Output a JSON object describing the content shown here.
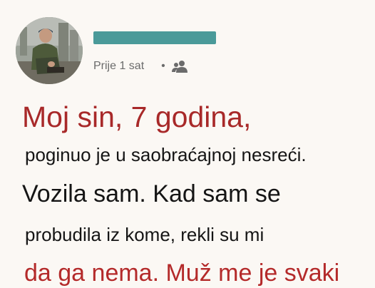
{
  "post": {
    "author": {
      "avatar_icon": "avatar-photo",
      "name_redaction_color": "#4a9a99"
    },
    "timestamp": "Prije 1 sat",
    "separator": "•",
    "audience_icon": "friends-icon",
    "body": {
      "line1": "Moj sin, 7 godina,",
      "line2": "poginuo je u saobraćajnoj nesreći.",
      "line3": "Vozila sam. Kad sam se",
      "line4": "probudila iz kome, rekli su mi",
      "line5": "da ga nema. Muž me je svaki"
    },
    "colors": {
      "background": "#fbf8f4",
      "headline_red": "#a82929",
      "body_text": "#151515",
      "meta_gray": "#6b6b6b"
    }
  }
}
